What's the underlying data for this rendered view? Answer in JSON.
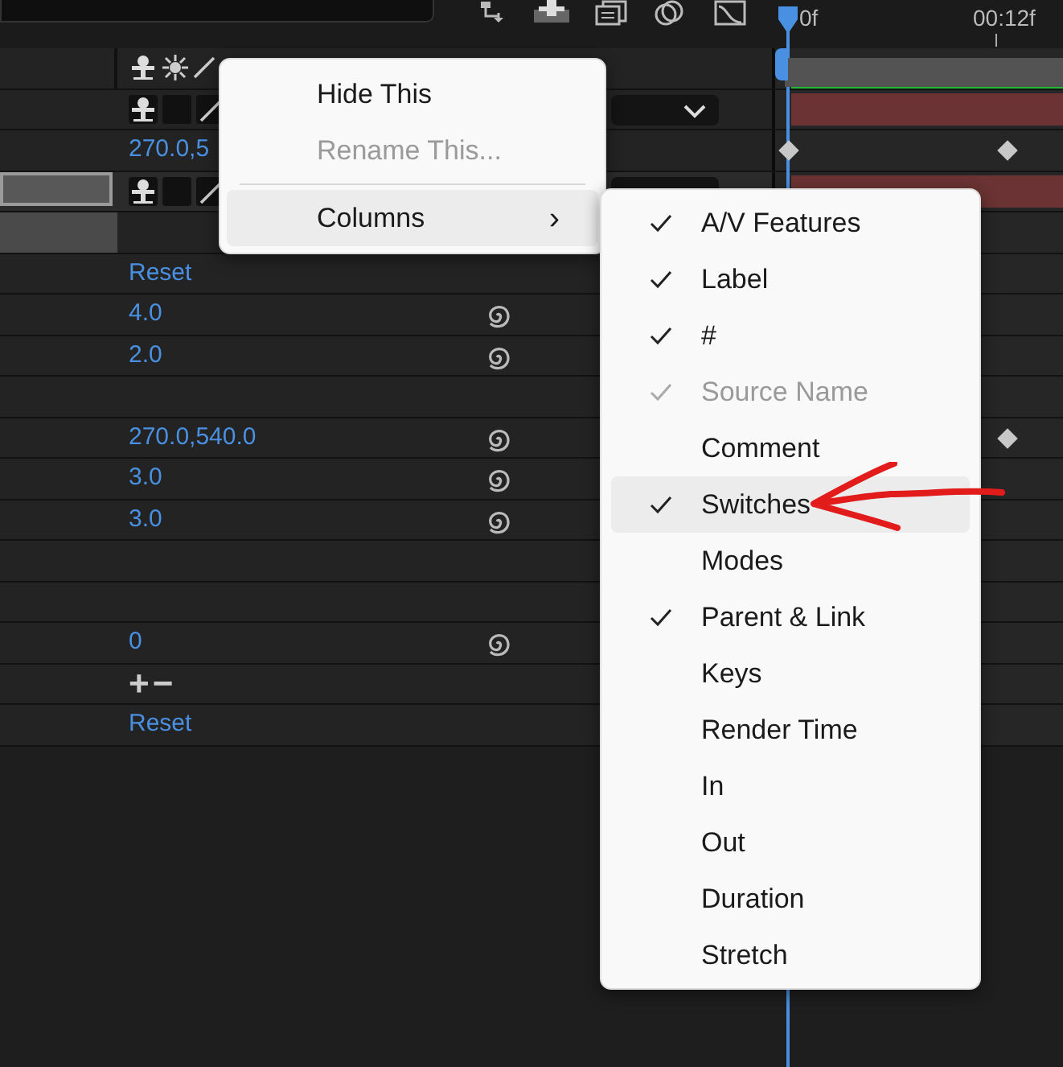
{
  "ruler": {
    "labels": [
      "0f",
      "00:12f"
    ]
  },
  "rows": [
    {
      "kind": "header"
    },
    {
      "kind": "layer",
      "selected": false,
      "dropdown_arrow": true
    },
    {
      "kind": "property",
      "value": "270.0,5",
      "graph": false,
      "start_keyframe": true,
      "end_keyframe": true
    },
    {
      "kind": "layer",
      "selected": true,
      "dropdown_arrow": false
    },
    {
      "kind": "group"
    },
    {
      "kind": "property",
      "value": "Reset",
      "graph": false
    },
    {
      "kind": "property",
      "value": "4.0",
      "graph": true
    },
    {
      "kind": "property",
      "value": "2.0",
      "graph": true
    },
    {
      "kind": "blank"
    },
    {
      "kind": "property",
      "value": "270.0,540.0",
      "graph": true,
      "end_keyframe": true
    },
    {
      "kind": "property",
      "value": "3.0",
      "graph": true
    },
    {
      "kind": "property",
      "value": "3.0",
      "graph": true
    },
    {
      "kind": "blank"
    },
    {
      "kind": "blank"
    },
    {
      "kind": "property",
      "value": "0",
      "graph": true
    },
    {
      "kind": "buttons",
      "labels": [
        "+",
        "−"
      ]
    },
    {
      "kind": "property",
      "value": "Reset",
      "graph": false
    }
  ],
  "context_menu": {
    "items": [
      {
        "kind": "item",
        "label": "Hide This",
        "disabled": false,
        "highlighted": false
      },
      {
        "kind": "item",
        "label": "Rename This...",
        "disabled": true,
        "highlighted": false
      },
      {
        "kind": "separator"
      },
      {
        "kind": "submenu",
        "label": "Columns",
        "arrow": "›",
        "disabled": false,
        "highlighted": true
      }
    ]
  },
  "columns_menu": {
    "items": [
      {
        "label": "A/V Features",
        "checked": true,
        "disabled": false,
        "highlighted": false
      },
      {
        "label": "Label",
        "checked": true,
        "disabled": false,
        "highlighted": false
      },
      {
        "label": "#",
        "checked": true,
        "disabled": false,
        "highlighted": false
      },
      {
        "label": "Source Name",
        "checked": true,
        "disabled": true,
        "highlighted": false
      },
      {
        "label": "Comment",
        "checked": false,
        "disabled": false,
        "highlighted": false
      },
      {
        "label": "Switches",
        "checked": true,
        "disabled": false,
        "highlighted": true
      },
      {
        "label": "Modes",
        "checked": false,
        "disabled": false,
        "highlighted": false
      },
      {
        "label": "Parent & Link",
        "checked": true,
        "disabled": false,
        "highlighted": false
      },
      {
        "label": "Keys",
        "checked": false,
        "disabled": false,
        "highlighted": false
      },
      {
        "label": "Render Time",
        "checked": false,
        "disabled": false,
        "highlighted": false
      },
      {
        "label": "In",
        "checked": false,
        "disabled": false,
        "highlighted": false
      },
      {
        "label": "Out",
        "checked": false,
        "disabled": false,
        "highlighted": false
      },
      {
        "label": "Duration",
        "checked": false,
        "disabled": false,
        "highlighted": false
      },
      {
        "label": "Stretch",
        "checked": false,
        "disabled": false,
        "highlighted": false
      }
    ]
  }
}
